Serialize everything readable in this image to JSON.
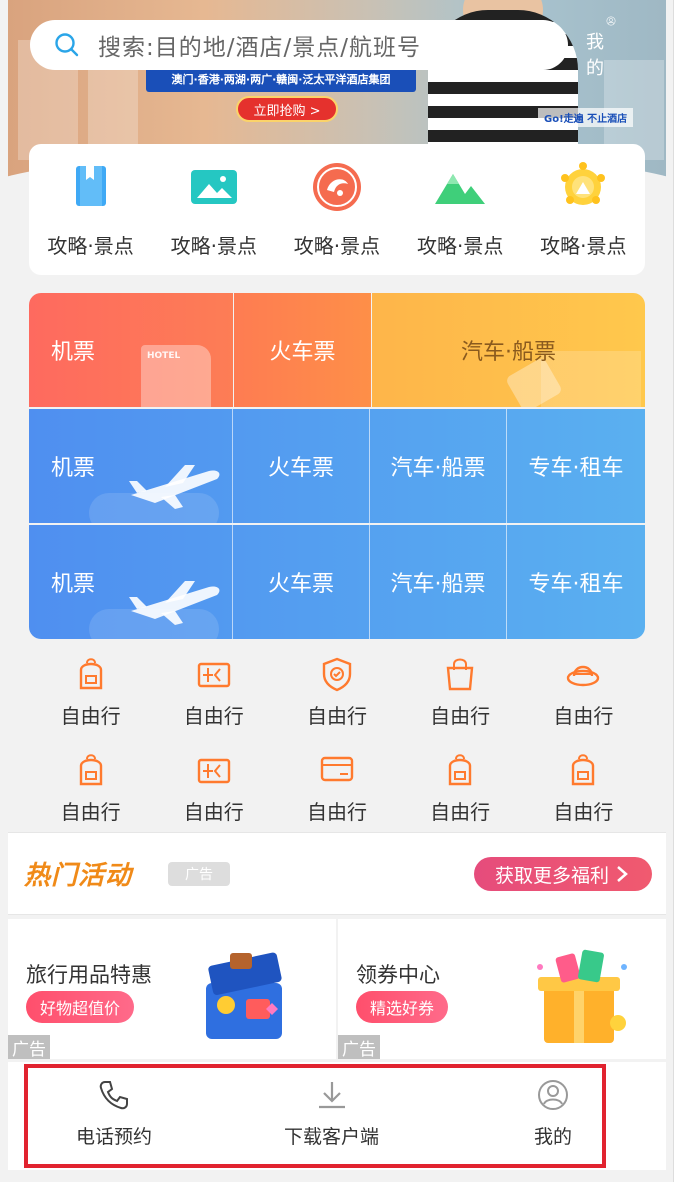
{
  "banner": {
    "strip_text": "澳门·香港·两湖·两广·赣闽·泛太平洋酒店集团",
    "cta_label": "立即抢购 >",
    "tagline": "Go!走遍 不止酒店"
  },
  "search": {
    "placeholder": "搜索:目的地/酒店/景点/航班号"
  },
  "header": {
    "me_label": "我 的"
  },
  "guide": {
    "items": [
      {
        "label": "攻略·景点",
        "icon": "book-icon"
      },
      {
        "label": "攻略·景点",
        "icon": "picture-icon"
      },
      {
        "label": "攻略·景点",
        "icon": "ctrip-logo-icon"
      },
      {
        "label": "攻略·景点",
        "icon": "mountain-icon"
      },
      {
        "label": "攻略·景点",
        "icon": "crown-icon"
      }
    ]
  },
  "transport": {
    "row1": {
      "c1": "机票",
      "c2": "火车票",
      "c3": "汽车·船票"
    },
    "row2": {
      "c1": "机票",
      "c2": "火车票",
      "c3": "汽车·船票",
      "c4": "专车·租车"
    },
    "row3": {
      "c1": "机票",
      "c2": "火车票",
      "c3": "汽车·船票",
      "c4": "专车·租车"
    },
    "colors": {
      "hotel": "#fe6a5f",
      "flight": "#4f8ff0",
      "travel": "#feb54a"
    }
  },
  "services": {
    "row1": [
      "自由行",
      "自由行",
      "自由行",
      "自由行",
      "自由行"
    ],
    "row2": [
      "自由行",
      "自由行",
      "自由行",
      "自由行",
      "自由行"
    ]
  },
  "hot": {
    "title": "热门活动",
    "ad_tag": "广告",
    "more_label": "获取更多福利"
  },
  "promos": [
    {
      "title": "旅行用品特惠",
      "pill": "好物超值价",
      "ad": "广告"
    },
    {
      "title": "领券中心",
      "pill": "精选好券",
      "ad": "广告"
    }
  ],
  "bottom_nav": {
    "phone": "电话预约",
    "download": "下载客户端",
    "me": "我的"
  }
}
